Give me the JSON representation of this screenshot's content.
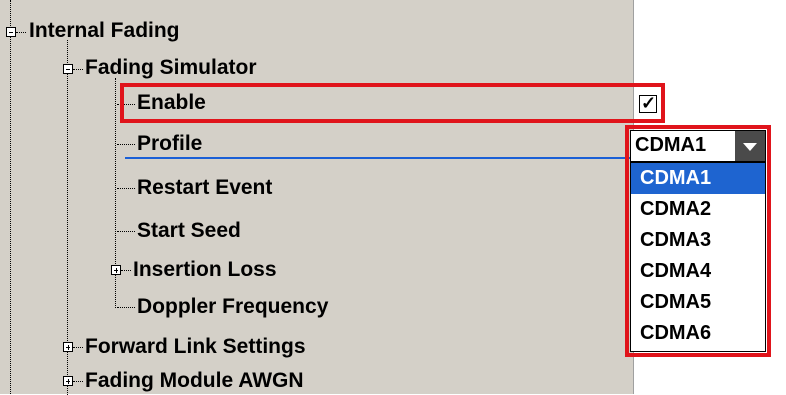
{
  "tree": {
    "internal_fading": "Internal Fading",
    "fading_simulator": "Fading Simulator",
    "enable": "Enable",
    "profile": "Profile",
    "restart_event": "Restart Event",
    "start_seed": "Start Seed",
    "insertion_loss": "Insertion Loss",
    "doppler_frequency": "Doppler Frequency",
    "forward_link_settings": "Forward Link Settings",
    "fading_module_awgn": "Fading Module AWGN"
  },
  "enable_check": "✓",
  "enable_checked": true,
  "profile_value": "CDMA1",
  "profile_options": [
    "CDMA1",
    "CDMA2",
    "CDMA3",
    "CDMA4",
    "CDMA5",
    "CDMA6"
  ],
  "colors": {
    "highlight_box": "#e0141b",
    "selection": "#1e64d0",
    "panel_bg": "#d4d0c8"
  }
}
